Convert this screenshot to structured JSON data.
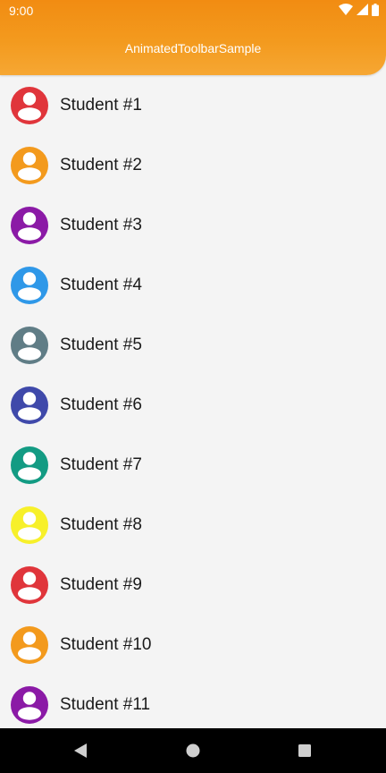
{
  "status_bar": {
    "time": "9:00",
    "icons": [
      "wifi-icon",
      "signal-icon",
      "battery-icon"
    ]
  },
  "toolbar": {
    "title": "AnimatedToolbarSample"
  },
  "students": [
    {
      "label": "Student #1",
      "color": "#e0353b"
    },
    {
      "label": "Student #2",
      "color": "#f39a1d"
    },
    {
      "label": "Student #3",
      "color": "#8b1aa6"
    },
    {
      "label": "Student #4",
      "color": "#2f98e8"
    },
    {
      "label": "Student #5",
      "color": "#607d86"
    },
    {
      "label": "Student #6",
      "color": "#3f49aa"
    },
    {
      "label": "Student #7",
      "color": "#139b83"
    },
    {
      "label": "Student #8",
      "color": "#f7f02a"
    },
    {
      "label": "Student #9",
      "color": "#e0353b"
    },
    {
      "label": "Student #10",
      "color": "#f39a1d"
    },
    {
      "label": "Student #11",
      "color": "#8b1aa6"
    }
  ],
  "nav_bar": {
    "buttons": [
      "back-icon",
      "home-icon",
      "recents-icon"
    ]
  },
  "colors": {
    "accent": "#f39a1e",
    "background": "#f4f4f4",
    "text": "#1a1a1a"
  }
}
